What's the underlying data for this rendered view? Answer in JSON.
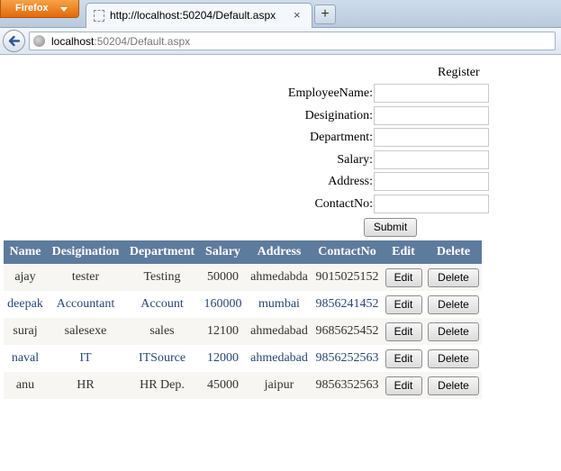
{
  "browser": {
    "menu_label": "Firefox",
    "tab_title": "http://localhost:50204/Default.aspx",
    "tab_close": "×",
    "new_tab": "+",
    "url_host": "localhost",
    "url_path": ":50204/Default.aspx"
  },
  "form": {
    "title": "Register",
    "fields": [
      {
        "label": "EmployeeName:",
        "value": ""
      },
      {
        "label": "Desigination:",
        "value": ""
      },
      {
        "label": "Department:",
        "value": ""
      },
      {
        "label": "Salary:",
        "value": ""
      },
      {
        "label": "Address:",
        "value": ""
      },
      {
        "label": "ContactNo:",
        "value": ""
      }
    ],
    "submit_label": "Submit"
  },
  "grid": {
    "headers": [
      "Name",
      "Desigination",
      "Department",
      "Salary",
      "Address",
      "ContactNo",
      "Edit",
      "Delete"
    ],
    "edit_label": "Edit",
    "delete_label": "Delete",
    "rows": [
      [
        "ajay",
        "tester",
        "Testing",
        "50000",
        "ahmedabda",
        "9015025152"
      ],
      [
        "deepak",
        "Accountant",
        "Account",
        "160000",
        "mumbai",
        "9856241452"
      ],
      [
        "suraj",
        "salesexe",
        "sales",
        "12100",
        "ahmedabad",
        "9685625452"
      ],
      [
        "naval",
        "IT",
        "ITSource",
        "12000",
        "ahmedabad",
        "9856252563"
      ],
      [
        "anu",
        "HR",
        "HR Dep.",
        "45000",
        "jaipur",
        "9856352563"
      ]
    ]
  },
  "colors": {
    "header_bg": "#5d7b9d",
    "row_odd_bg": "#f7f6f3",
    "row_even_text": "#284775",
    "firefox_orange": "#e06a0c"
  },
  "icons": {
    "back": "back-arrow-icon",
    "site": "globe-icon",
    "page": "page-icon"
  }
}
